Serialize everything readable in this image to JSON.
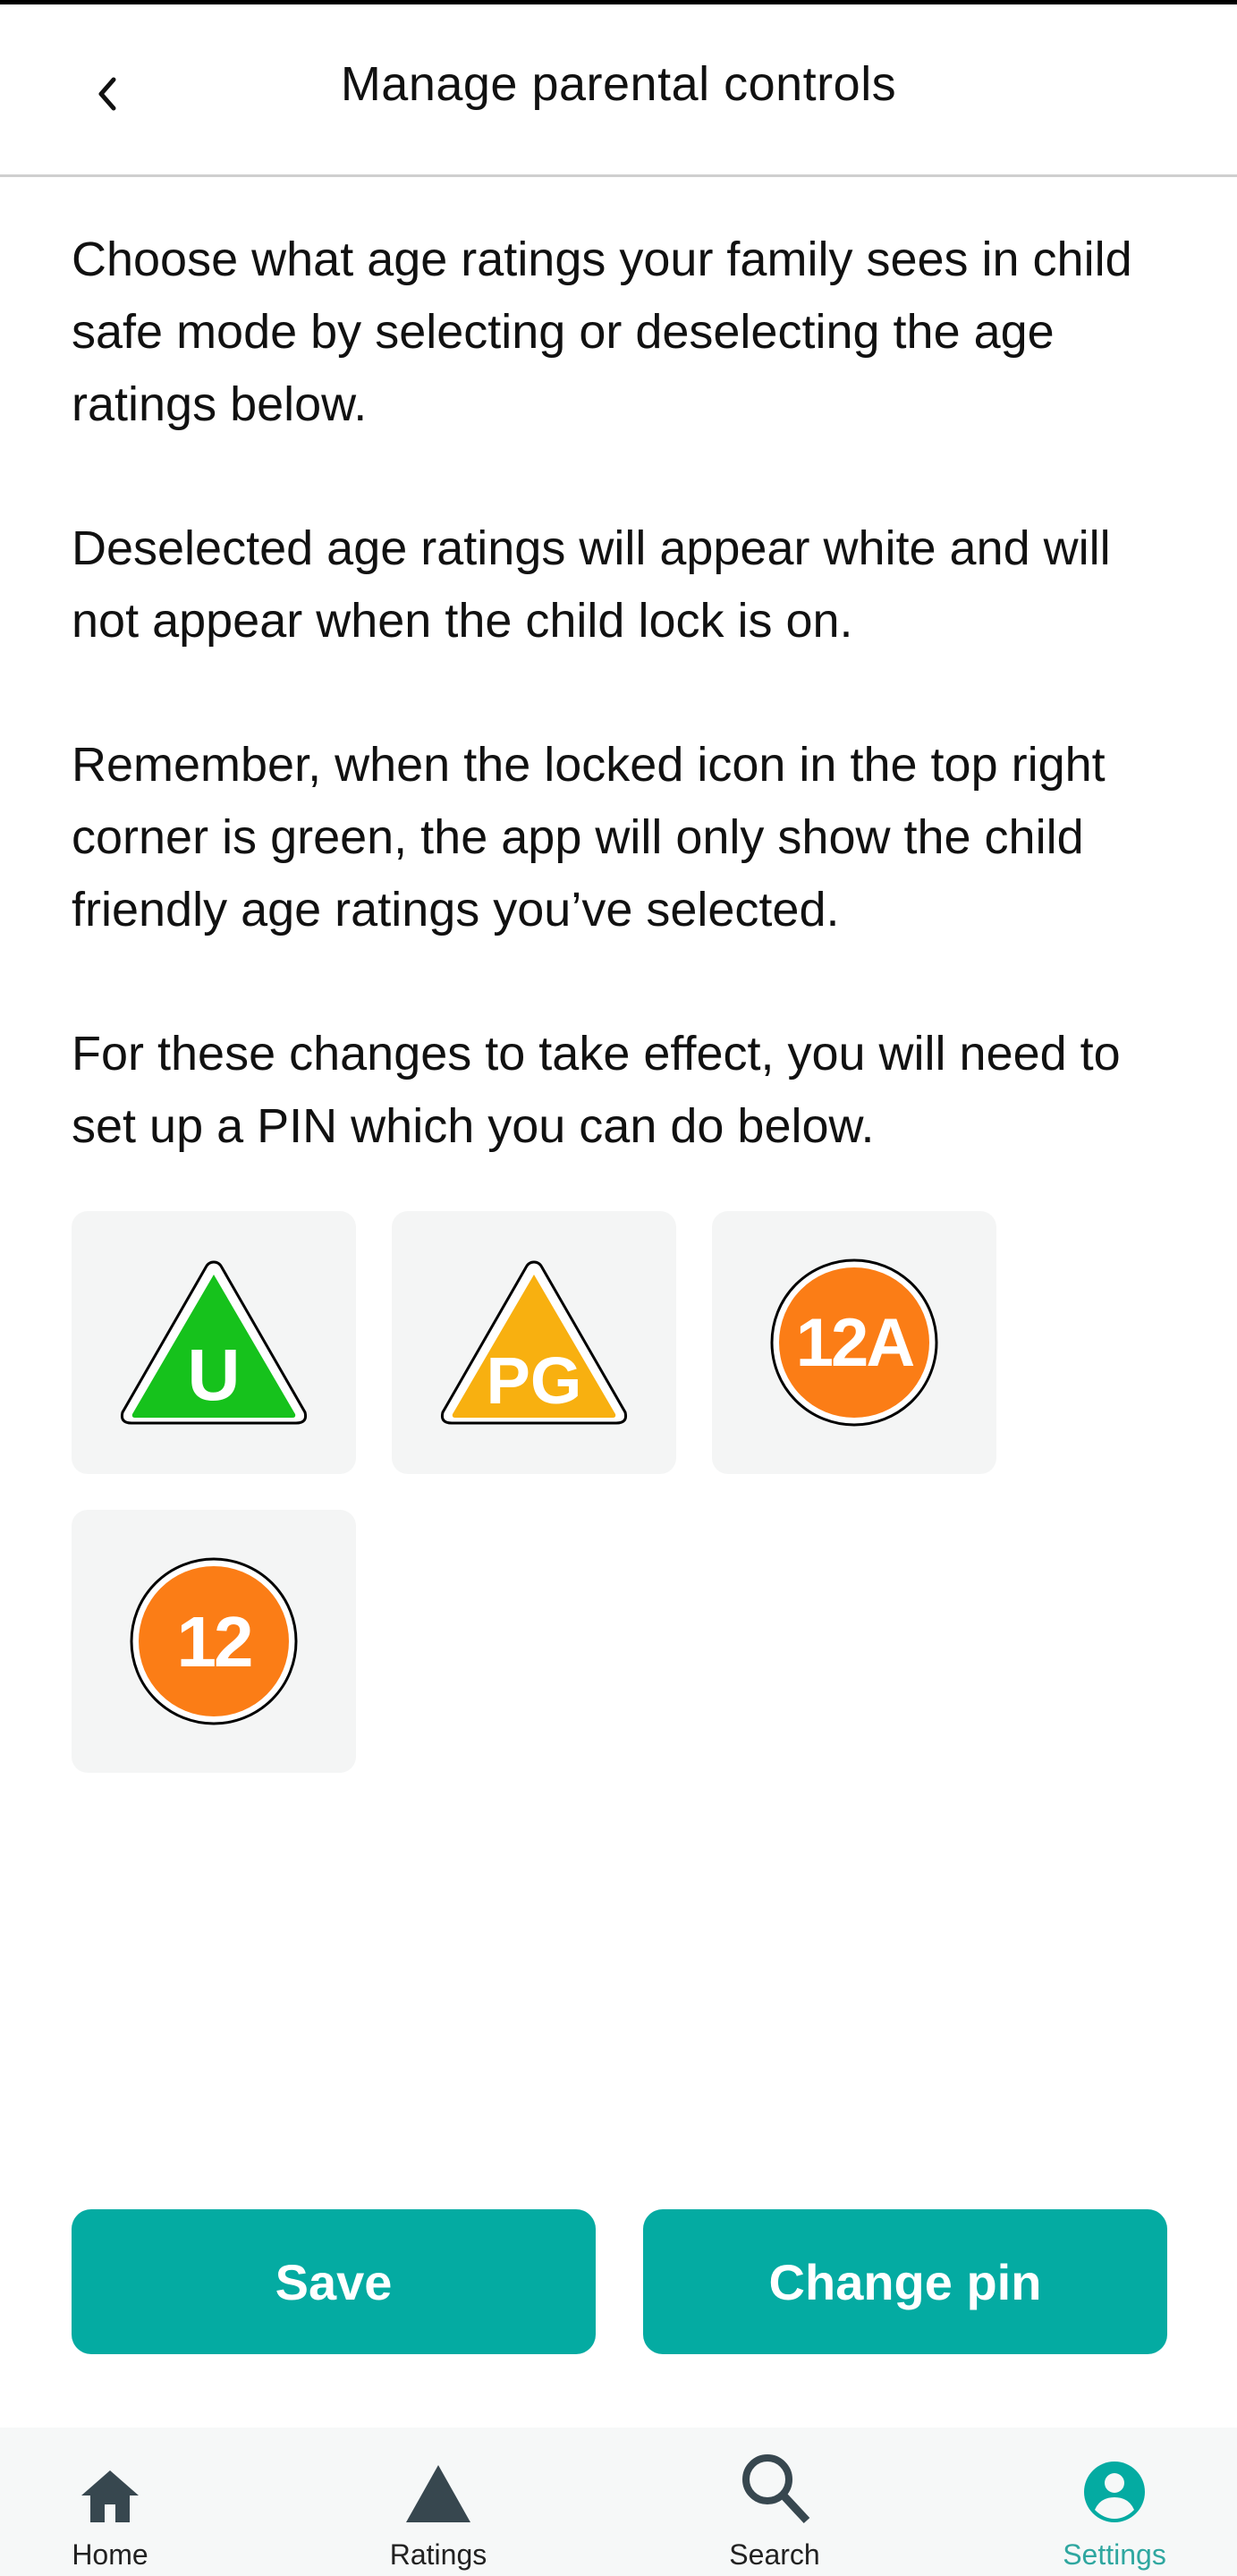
{
  "header": {
    "title": "Manage parental controls",
    "back_icon": "chevron-left-icon"
  },
  "content": {
    "paragraphs": [
      "Choose what age ratings your family sees in child safe mode by selecting or deselecting the age ratings below.",
      "Deselected age ratings will appear white and will not appear when the child lock is on.",
      "Remember, when the locked icon in the top right corner is green, the app will only show the child friendly age ratings you’ve selected.",
      "For these changes to take effect, you will need to set up a PIN which you can do below."
    ]
  },
  "ratings": [
    {
      "label": "U",
      "shape": "triangle",
      "color": "#16c21c",
      "selected": true
    },
    {
      "label": "PG",
      "shape": "triangle",
      "color": "#f8b010",
      "selected": true
    },
    {
      "label": "12A",
      "shape": "circle",
      "color": "#fb7d16",
      "selected": true
    },
    {
      "label": "12",
      "shape": "circle",
      "color": "#fb7d16",
      "selected": true
    }
  ],
  "buttons": {
    "save_label": "Save",
    "change_pin_label": "Change pin"
  },
  "nav": {
    "items": [
      {
        "label": "Home",
        "icon": "home-icon",
        "active": false
      },
      {
        "label": "Ratings",
        "icon": "triangle-icon",
        "active": false
      },
      {
        "label": "Search",
        "icon": "search-icon",
        "active": false
      },
      {
        "label": "Settings",
        "icon": "account-circle-icon",
        "active": true
      }
    ]
  },
  "colors": {
    "accent": "#04aba2",
    "nav_icon": "#37474f",
    "tile_bg": "#f4f5f5"
  }
}
